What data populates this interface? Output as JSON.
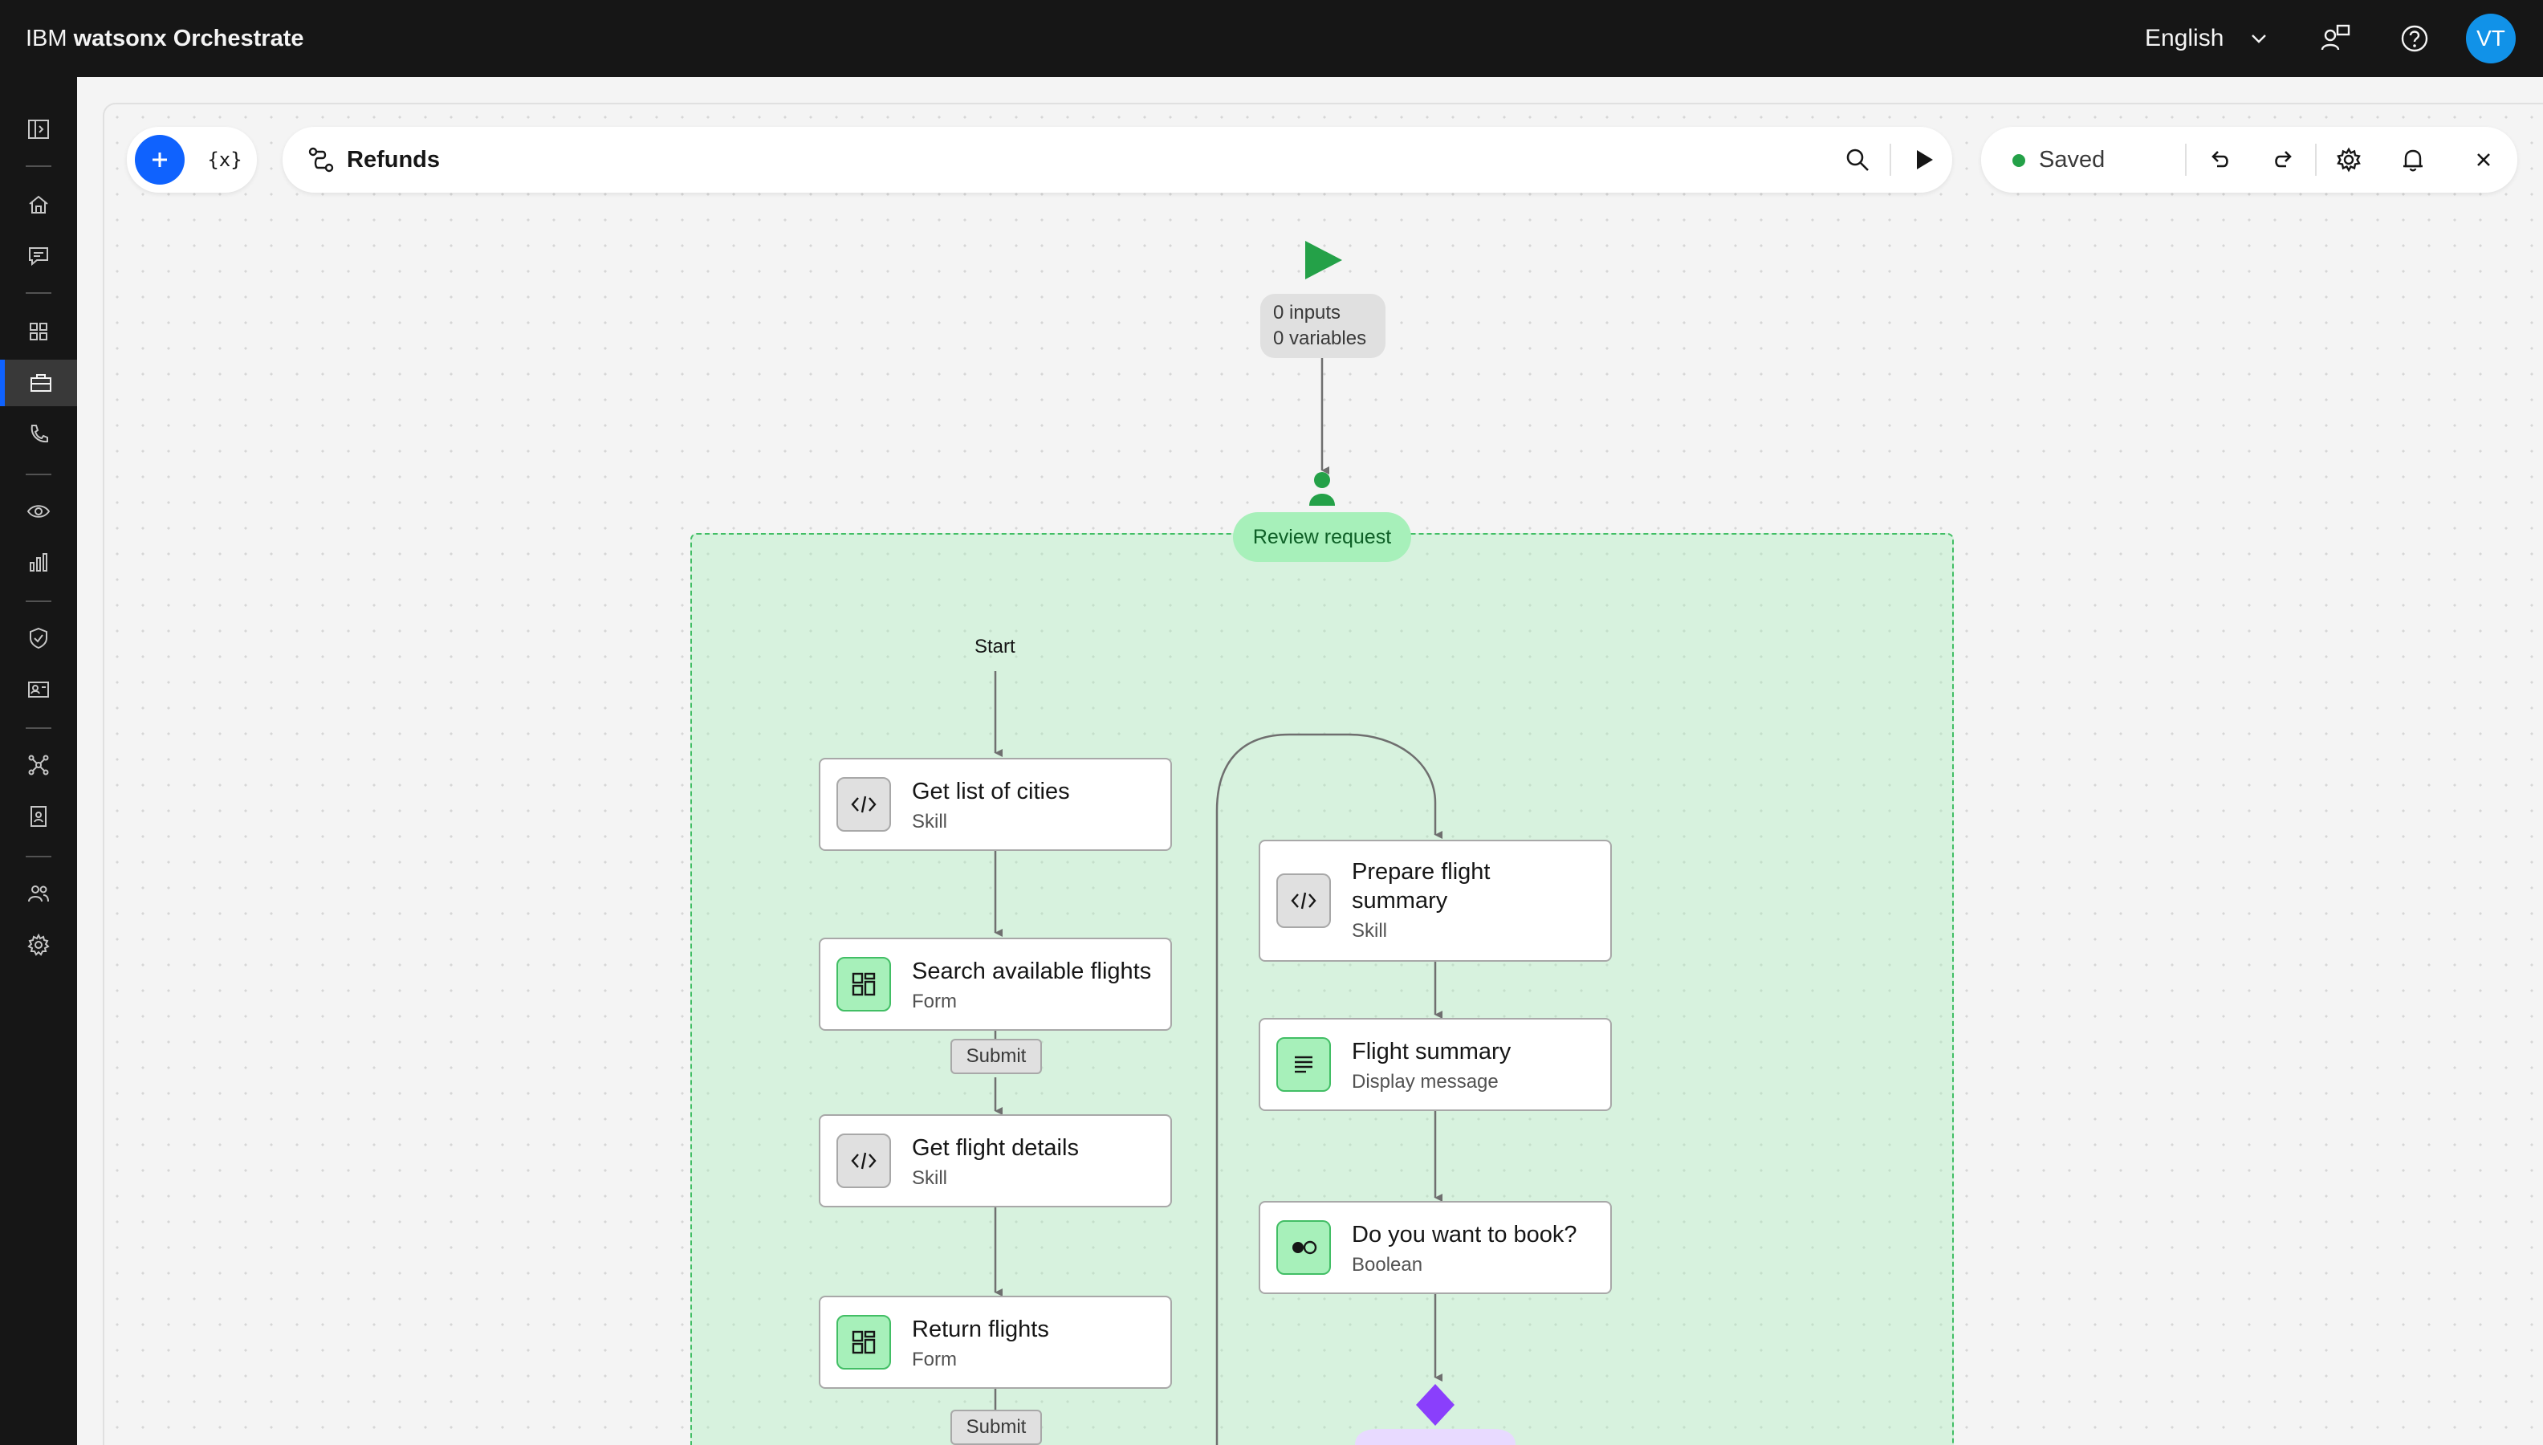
{
  "topbar": {
    "brand_prefix": "IBM",
    "brand_product": "watsonx Orchestrate",
    "language": "English",
    "avatar_initials": "VT"
  },
  "toolbar": {
    "flow_title": "Refunds",
    "variables_label": "{x}",
    "status": "Saved"
  },
  "flow": {
    "io_inputs": "0 inputs",
    "io_variables": "0 variables",
    "review_label": "Review request",
    "start_label": "Start",
    "submit_label": "Submit",
    "nodes": [
      {
        "title": "Get list of cities",
        "sub": "Skill",
        "icon": "code-icon"
      },
      {
        "title": "Search available flights",
        "sub": "Form",
        "icon": "form-icon"
      },
      {
        "title": "Get flight details",
        "sub": "Skill",
        "icon": "code-icon"
      },
      {
        "title": "Return flights",
        "sub": "Form",
        "icon": "form-icon"
      },
      {
        "title": "Prepare flight summary",
        "sub": "Skill",
        "icon": "code-icon"
      },
      {
        "title": "Flight summary",
        "sub": "Display message",
        "icon": "message-icon"
      },
      {
        "title": "Do you want to book?",
        "sub": "Boolean",
        "icon": "boolean-icon"
      }
    ]
  },
  "colors": {
    "accent": "#0f62fe",
    "success": "#24a148",
    "group_border": "#42be65",
    "decision": "#8a3ffc"
  }
}
